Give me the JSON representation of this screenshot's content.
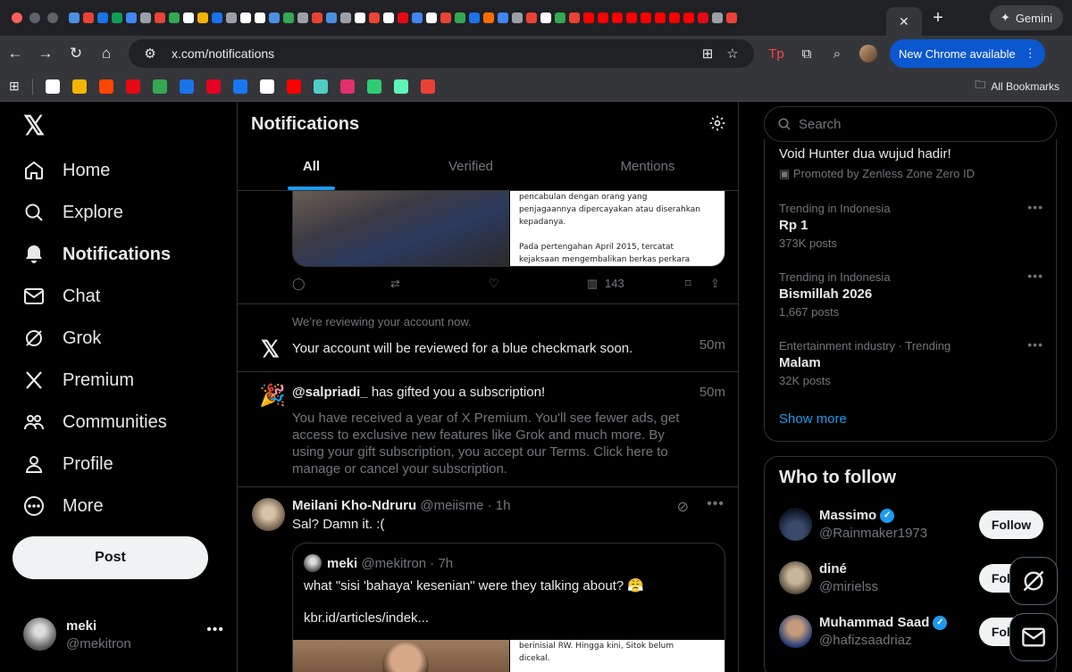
{
  "browser": {
    "active_tab_close": "✕",
    "new_tab": "+",
    "gemini_label": "Gemini",
    "url": "x.com/notifications",
    "new_chrome_label": "New Chrome available",
    "all_bookmarks": "All Bookmarks",
    "favicon_colors": [
      "#4a90e2",
      "#ea4335",
      "#1a73e8",
      "#0f9d58",
      "#4285f4",
      "#9aa0a6",
      "#ea4335",
      "#34a853",
      "#ffffff",
      "#f4b400",
      "#1a73e8",
      "#9aa0a6",
      "#ffffff",
      "#ffffff",
      "#4a90e2",
      "#34a853",
      "#9aa0a6",
      "#ea4335",
      "#4a90e2",
      "#9aa0a6",
      "#ffffff",
      "#ea4335",
      "#ffffff",
      "#e50914",
      "#4285f4",
      "#ffffff",
      "#ea4335",
      "#34a853",
      "#1a73e8",
      "#ff6d00",
      "#4285f4",
      "#9aa0a6",
      "#ea4335",
      "#ffffff",
      "#34a853",
      "#ea4335",
      "#ff0000",
      "#ff0000",
      "#ff0000",
      "#ff0000",
      "#ff0000",
      "#ff0000",
      "#ff0000",
      "#ff0000",
      "#e50914",
      "#9aa0a6",
      "#ea4335"
    ],
    "bookmark_colors": [
      "#ffffff",
      "#f4b400",
      "#ff4500",
      "#e50914",
      "#34a853",
      "#1a73e8",
      "#e60023",
      "#1877f2",
      "#ffffff",
      "#ff0000",
      "#4ecdc4",
      "#e1306c",
      "#2ecc71",
      "#5ff5b9",
      "#ea4335"
    ]
  },
  "nav": {
    "items": [
      {
        "label": "Home",
        "icon": "home-icon"
      },
      {
        "label": "Explore",
        "icon": "search-icon"
      },
      {
        "label": "Notifications",
        "icon": "bell-icon"
      },
      {
        "label": "Chat",
        "icon": "mail-icon"
      },
      {
        "label": "Grok",
        "icon": "grok-icon"
      },
      {
        "label": "Premium",
        "icon": "x-logo-icon"
      },
      {
        "label": "Communities",
        "icon": "people-icon"
      },
      {
        "label": "Profile",
        "icon": "person-icon"
      },
      {
        "label": "More",
        "icon": "more-circle-icon"
      }
    ],
    "post_label": "Post",
    "me_name": "meki",
    "me_handle": "@mekitron"
  },
  "center": {
    "title": "Notifications",
    "tabs": [
      "All",
      "Verified",
      "Mentions"
    ],
    "top_doc_lines": [
      "pencabulan dengan orang yang",
      "penjagaannya dipercayakan atau diserahkan",
      "kepadanya.",
      "",
      "Pada pertengahan April 2015, tercatat",
      "kejaksaan mengembalikan berkas perkara"
    ],
    "views": "143",
    "review_label": "We’re reviewing your account now.",
    "review_text": "Your account will be reviewed for a blue checkmark soon.",
    "review_time": "50m",
    "gift_user": "@salpriadi_",
    "gift_action": " has gifted you a subscription!",
    "gift_time": "50m",
    "gift_body": "You have received a year of X Premium. You'll see fewer ads, get access to exclusive new features like Grok and much more. By using your gift subscription, you accept our Terms. Click here to manage or cancel your subscription.",
    "tweet_name": "Meilani Kho-Ndruru",
    "tweet_handle": "@meiisme",
    "tweet_time": "· 1h",
    "tweet_text": "Sal? Damn it. :(",
    "quote_name": "meki",
    "quote_handle": "@mekitron",
    "quote_time": "· 7h",
    "quote_text": "what \"sisi 'bahaya' kesenian\" were they talking about? 😤",
    "quote_link": "kbr.id/articles/indek...",
    "quote_doc_lines": [
      "berinisial RW. Hingga kini, Sitok belum",
      "dicekal."
    ]
  },
  "right": {
    "search_placeholder": "Search",
    "promo_title": "Void Hunter dua wujud hadir!",
    "promo_by": "Promoted by Zenless Zone Zero ID",
    "trends": [
      {
        "context": "Trending in Indonesia",
        "name": "Rp 1",
        "posts": "373K posts"
      },
      {
        "context": "Trending in Indonesia",
        "name": "Bismillah 2026",
        "posts": "1,667 posts"
      },
      {
        "context": "Entertainment industry · Trending",
        "name": "Malam",
        "posts": "32K posts"
      }
    ],
    "show_more": "Show more",
    "wtf_title": "Who to follow",
    "follow": [
      {
        "name": "Massimo",
        "handle": "@Rainmaker1973",
        "verified": true,
        "button": "Follow",
        "avatar": "#1a2a4a"
      },
      {
        "name": "diné",
        "handle": "@mirielss",
        "verified": false,
        "button": "Follow",
        "avatar": "#b8a890"
      },
      {
        "name": "Muhammad Saad",
        "handle": "@hafizsaadriaz",
        "verified": true,
        "button": "Follow",
        "avatar": "#2a4a8a"
      }
    ]
  }
}
